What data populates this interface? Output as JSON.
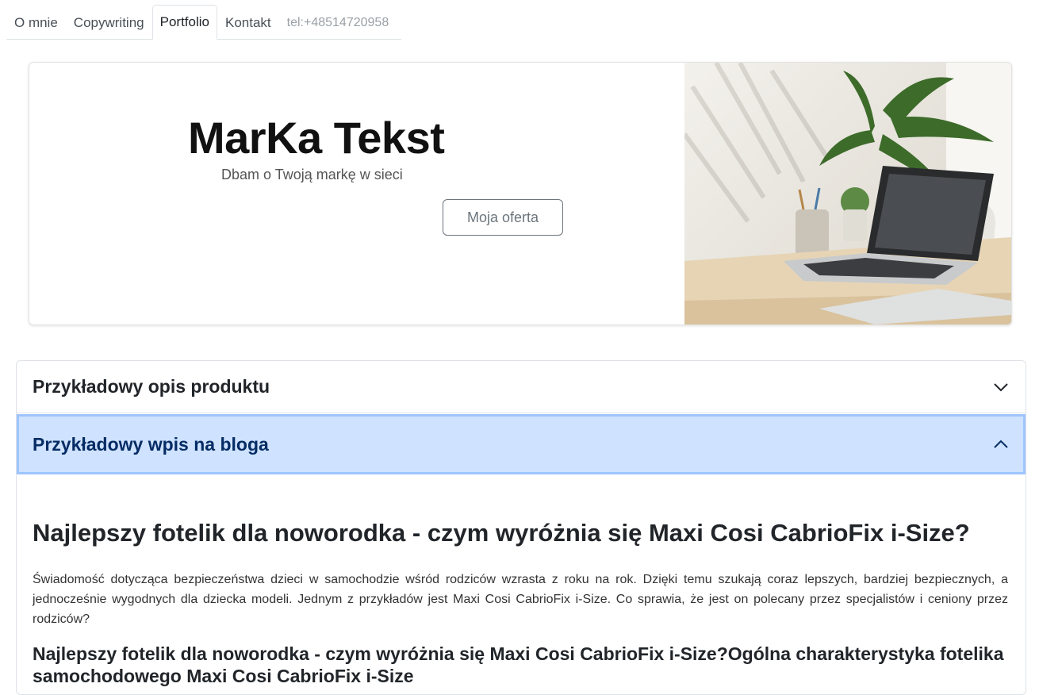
{
  "nav": {
    "items": [
      "O mnie",
      "Copywriting",
      "Portfolio",
      "Kontakt"
    ],
    "active": "Portfolio",
    "phone": "tel:+48514720958"
  },
  "hero": {
    "title": "MarKa Tekst",
    "subtitle": "Dbam o Twoją markę w sieci",
    "button": "Moja oferta"
  },
  "accordion": {
    "item1": {
      "label": "Przykładowy opis produktu",
      "expanded": false
    },
    "item2": {
      "label": "Przykładowy wpis na bloga",
      "expanded": true
    }
  },
  "article": {
    "title": "Najlepszy fotelik dla noworodka - czym wyróżnia się Maxi Cosi CabrioFix i-Size?",
    "paragraph": "Świadomość dotycząca bezpieczeństwa dzieci w samochodzie wśród rodziców wzrasta z roku na rok. Dzięki temu szukają coraz lepszych, bardziej bezpiecznych, a jednocześnie wygodnych dla dziecka modeli. Jednym z przykładów jest Maxi Cosi CabrioFix i-Size. Co sprawia, że jest on polecany przez specjalistów i ceniony przez rodziców?",
    "subheading": "Najlepszy fotelik dla noworodka - czym wyróżnia się Maxi Cosi CabrioFix i-Size?Ogólna charakterystyka fotelika samochodowego Maxi Cosi CabrioFix i-Size"
  },
  "icons": {
    "chevron_down": "chevron-down-icon",
    "chevron_up": "chevron-up-icon"
  },
  "colors": {
    "accordion_active_bg": "#cfe2ff",
    "accordion_active_text": "#052c65"
  }
}
